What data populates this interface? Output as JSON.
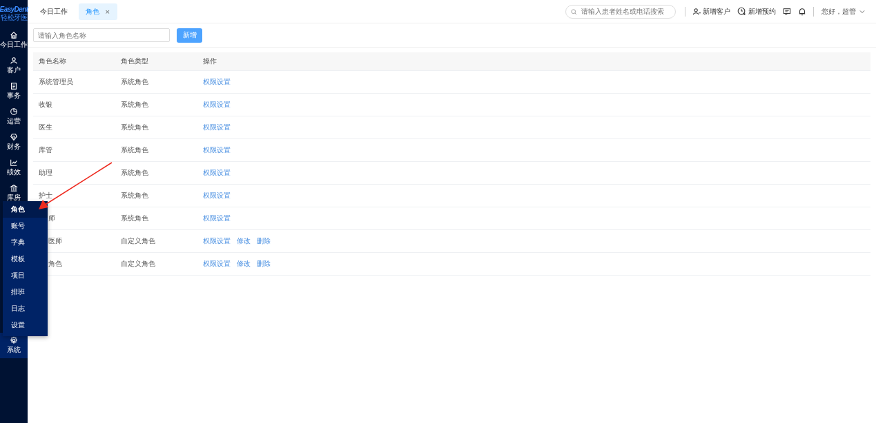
{
  "logo": {
    "brand": "EasyDent",
    "subtitle": "轻松牙医"
  },
  "sidebar": {
    "items": [
      {
        "label": "今日工作",
        "selected": false
      },
      {
        "label": "客户",
        "selected": false
      },
      {
        "label": "事务",
        "selected": false
      },
      {
        "label": "运营",
        "selected": false
      },
      {
        "label": "财务",
        "selected": false
      },
      {
        "label": "绩效",
        "selected": false
      },
      {
        "label": "库房",
        "selected": false
      },
      {
        "label": "系统",
        "selected": true
      }
    ]
  },
  "submenu": {
    "items": [
      {
        "label": "角色",
        "selected": true
      },
      {
        "label": "账号",
        "selected": false
      },
      {
        "label": "字典",
        "selected": false
      },
      {
        "label": "模板",
        "selected": false
      },
      {
        "label": "项目",
        "selected": false
      },
      {
        "label": "排班",
        "selected": false
      },
      {
        "label": "日志",
        "selected": false
      },
      {
        "label": "设置",
        "selected": false
      }
    ]
  },
  "tabs": [
    {
      "label": "今日工作",
      "selected": false
    },
    {
      "label": "角色",
      "selected": true,
      "close": "×"
    }
  ],
  "header": {
    "search": {
      "placeholder": "请输入患者姓名或电话搜索"
    },
    "new_customer": "新增客户",
    "new_appointment": "新增预约",
    "user": "您好，超管"
  },
  "filter": {
    "placeholder": "请输入角色名称",
    "add": "新增"
  },
  "table": {
    "columns": [
      "角色名称",
      "角色类型",
      "操作"
    ],
    "rows": [
      {
        "name": "系统管理员",
        "covered": false,
        "type": "系统角色",
        "actions": [
          "权限设置"
        ]
      },
      {
        "name": "收银",
        "covered": false,
        "type": "系统角色",
        "actions": [
          "权限设置"
        ]
      },
      {
        "name": "医生",
        "covered": false,
        "type": "系统角色",
        "actions": [
          "权限设置"
        ]
      },
      {
        "name": "库管",
        "covered": false,
        "type": "系统角色",
        "actions": [
          "权限设置"
        ]
      },
      {
        "name": "助理",
        "covered": false,
        "type": "系统角色",
        "actions": [
          "权限设置"
        ]
      },
      {
        "name": "护士",
        "covered": false,
        "type": "系统角色",
        "actions": [
          "权限设置"
        ]
      },
      {
        "name": "师",
        "covered": true,
        "type": "系统角色",
        "actions": [
          "权限设置"
        ]
      },
      {
        "name": "医师",
        "covered": true,
        "type": "自定义角色",
        "actions": [
          "权限设置",
          "修改",
          "删除"
        ]
      },
      {
        "name": "角色",
        "covered": true,
        "type": "自定义角色",
        "actions": [
          "权限设置",
          "修改",
          "删除"
        ]
      }
    ]
  }
}
